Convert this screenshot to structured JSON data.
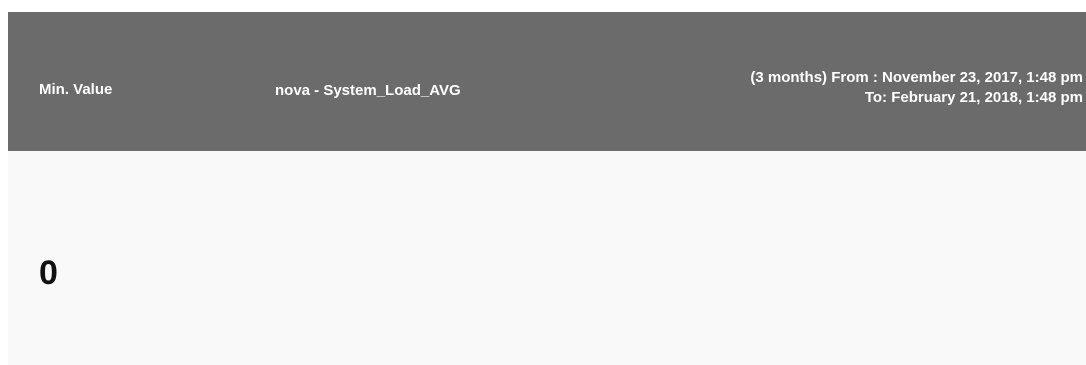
{
  "widget": {
    "metric_label": "Min. Value",
    "series_name": "nova - System_Load_AVG",
    "range_from": "(3 months) From : November 23, 2017, 1:48 pm",
    "range_to": "To: February 21, 2018, 1:48 pm",
    "value": "0"
  },
  "colors": {
    "header_bg": "#6b6b6b",
    "body_bg": "#f9f9f9",
    "header_text": "#ffffff",
    "value_text": "#111111"
  }
}
